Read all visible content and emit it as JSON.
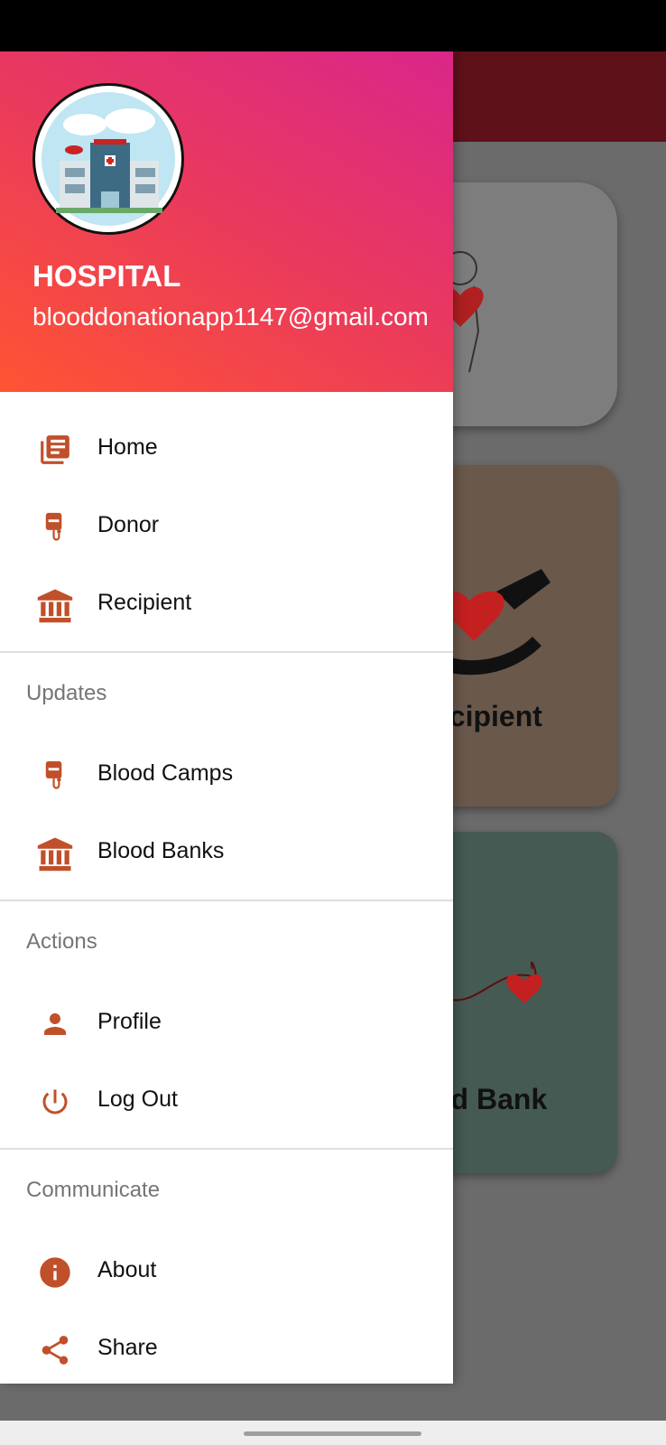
{
  "drawer": {
    "header": {
      "title": "HOSPITAL",
      "email": "blooddonationapp1147@gmail.com"
    },
    "primary_items": [
      {
        "label": "Home",
        "icon": "list-document-icon"
      },
      {
        "label": "Donor",
        "icon": "blood-bag-icon"
      },
      {
        "label": "Recipient",
        "icon": "bank-building-icon"
      }
    ],
    "sections": [
      {
        "title": "Updates",
        "items": [
          {
            "label": "Blood Camps",
            "icon": "blood-bag-icon"
          },
          {
            "label": "Blood Banks",
            "icon": "bank-building-icon"
          }
        ]
      },
      {
        "title": "Actions",
        "items": [
          {
            "label": "Profile",
            "icon": "person-icon"
          },
          {
            "label": "Log Out",
            "icon": "power-icon"
          }
        ]
      },
      {
        "title": "Communicate",
        "items": [
          {
            "label": "About",
            "icon": "info-icon"
          },
          {
            "label": "Share",
            "icon": "share-icon"
          }
        ]
      }
    ]
  },
  "background": {
    "card_recipient_label": "ecipient",
    "card_bloodbank_label": "od Bank"
  },
  "colors": {
    "icon": "#c0502a",
    "toolbar": "#5e1119",
    "header_gradient_start": "#ff5433",
    "header_gradient_end": "#d9268a"
  }
}
